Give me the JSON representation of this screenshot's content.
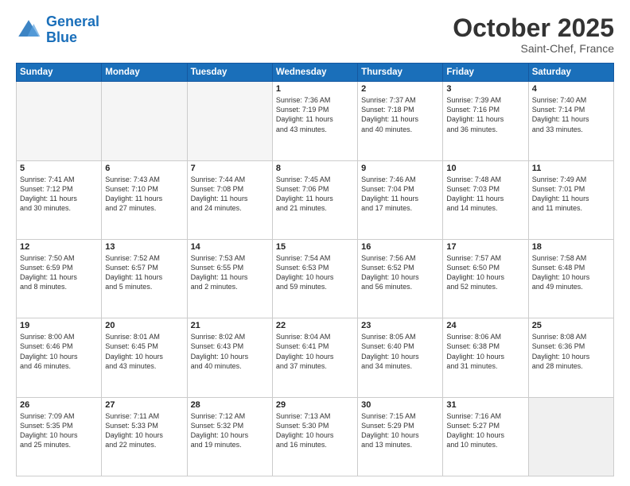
{
  "header": {
    "logo_line1": "General",
    "logo_line2": "Blue",
    "month": "October 2025",
    "location": "Saint-Chef, France"
  },
  "days_of_week": [
    "Sunday",
    "Monday",
    "Tuesday",
    "Wednesday",
    "Thursday",
    "Friday",
    "Saturday"
  ],
  "weeks": [
    [
      {
        "day": "",
        "info": "",
        "empty": true
      },
      {
        "day": "",
        "info": "",
        "empty": true
      },
      {
        "day": "",
        "info": "",
        "empty": true
      },
      {
        "day": "1",
        "info": "Sunrise: 7:36 AM\nSunset: 7:19 PM\nDaylight: 11 hours\nand 43 minutes."
      },
      {
        "day": "2",
        "info": "Sunrise: 7:37 AM\nSunset: 7:18 PM\nDaylight: 11 hours\nand 40 minutes."
      },
      {
        "day": "3",
        "info": "Sunrise: 7:39 AM\nSunset: 7:16 PM\nDaylight: 11 hours\nand 36 minutes."
      },
      {
        "day": "4",
        "info": "Sunrise: 7:40 AM\nSunset: 7:14 PM\nDaylight: 11 hours\nand 33 minutes."
      }
    ],
    [
      {
        "day": "5",
        "info": "Sunrise: 7:41 AM\nSunset: 7:12 PM\nDaylight: 11 hours\nand 30 minutes."
      },
      {
        "day": "6",
        "info": "Sunrise: 7:43 AM\nSunset: 7:10 PM\nDaylight: 11 hours\nand 27 minutes."
      },
      {
        "day": "7",
        "info": "Sunrise: 7:44 AM\nSunset: 7:08 PM\nDaylight: 11 hours\nand 24 minutes."
      },
      {
        "day": "8",
        "info": "Sunrise: 7:45 AM\nSunset: 7:06 PM\nDaylight: 11 hours\nand 21 minutes."
      },
      {
        "day": "9",
        "info": "Sunrise: 7:46 AM\nSunset: 7:04 PM\nDaylight: 11 hours\nand 17 minutes."
      },
      {
        "day": "10",
        "info": "Sunrise: 7:48 AM\nSunset: 7:03 PM\nDaylight: 11 hours\nand 14 minutes."
      },
      {
        "day": "11",
        "info": "Sunrise: 7:49 AM\nSunset: 7:01 PM\nDaylight: 11 hours\nand 11 minutes."
      }
    ],
    [
      {
        "day": "12",
        "info": "Sunrise: 7:50 AM\nSunset: 6:59 PM\nDaylight: 11 hours\nand 8 minutes."
      },
      {
        "day": "13",
        "info": "Sunrise: 7:52 AM\nSunset: 6:57 PM\nDaylight: 11 hours\nand 5 minutes."
      },
      {
        "day": "14",
        "info": "Sunrise: 7:53 AM\nSunset: 6:55 PM\nDaylight: 11 hours\nand 2 minutes."
      },
      {
        "day": "15",
        "info": "Sunrise: 7:54 AM\nSunset: 6:53 PM\nDaylight: 10 hours\nand 59 minutes."
      },
      {
        "day": "16",
        "info": "Sunrise: 7:56 AM\nSunset: 6:52 PM\nDaylight: 10 hours\nand 56 minutes."
      },
      {
        "day": "17",
        "info": "Sunrise: 7:57 AM\nSunset: 6:50 PM\nDaylight: 10 hours\nand 52 minutes."
      },
      {
        "day": "18",
        "info": "Sunrise: 7:58 AM\nSunset: 6:48 PM\nDaylight: 10 hours\nand 49 minutes."
      }
    ],
    [
      {
        "day": "19",
        "info": "Sunrise: 8:00 AM\nSunset: 6:46 PM\nDaylight: 10 hours\nand 46 minutes."
      },
      {
        "day": "20",
        "info": "Sunrise: 8:01 AM\nSunset: 6:45 PM\nDaylight: 10 hours\nand 43 minutes."
      },
      {
        "day": "21",
        "info": "Sunrise: 8:02 AM\nSunset: 6:43 PM\nDaylight: 10 hours\nand 40 minutes."
      },
      {
        "day": "22",
        "info": "Sunrise: 8:04 AM\nSunset: 6:41 PM\nDaylight: 10 hours\nand 37 minutes."
      },
      {
        "day": "23",
        "info": "Sunrise: 8:05 AM\nSunset: 6:40 PM\nDaylight: 10 hours\nand 34 minutes."
      },
      {
        "day": "24",
        "info": "Sunrise: 8:06 AM\nSunset: 6:38 PM\nDaylight: 10 hours\nand 31 minutes."
      },
      {
        "day": "25",
        "info": "Sunrise: 8:08 AM\nSunset: 6:36 PM\nDaylight: 10 hours\nand 28 minutes."
      }
    ],
    [
      {
        "day": "26",
        "info": "Sunrise: 7:09 AM\nSunset: 5:35 PM\nDaylight: 10 hours\nand 25 minutes."
      },
      {
        "day": "27",
        "info": "Sunrise: 7:11 AM\nSunset: 5:33 PM\nDaylight: 10 hours\nand 22 minutes."
      },
      {
        "day": "28",
        "info": "Sunrise: 7:12 AM\nSunset: 5:32 PM\nDaylight: 10 hours\nand 19 minutes."
      },
      {
        "day": "29",
        "info": "Sunrise: 7:13 AM\nSunset: 5:30 PM\nDaylight: 10 hours\nand 16 minutes."
      },
      {
        "day": "30",
        "info": "Sunrise: 7:15 AM\nSunset: 5:29 PM\nDaylight: 10 hours\nand 13 minutes."
      },
      {
        "day": "31",
        "info": "Sunrise: 7:16 AM\nSunset: 5:27 PM\nDaylight: 10 hours\nand 10 minutes."
      },
      {
        "day": "",
        "info": "",
        "empty": true
      }
    ]
  ]
}
